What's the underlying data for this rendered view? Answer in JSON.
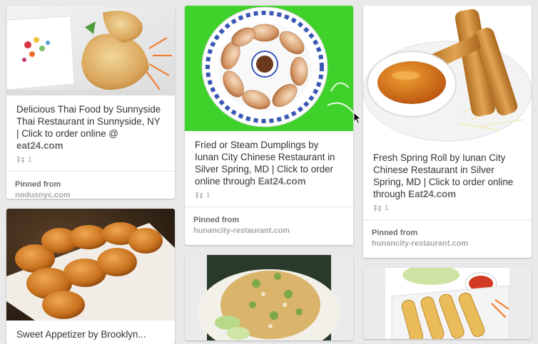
{
  "pins": [
    {
      "id": "p1",
      "description": "Delicious Thai Food by Sunnyside Thai Restaurant in Sunnyside, NY | Click to order online @ ",
      "link_text": "eat24.com",
      "repins": "1",
      "pinned_from_label": "Pinned from",
      "source_domain": "nodusnyc.com"
    },
    {
      "id": "p2",
      "description": "Fried or Steam Dumplings by Iunan City Chinese Restaurant in Silver Spring, MD | Click to order online through ",
      "link_text": "Eat24.com",
      "repins": "1",
      "pinned_from_label": "Pinned from",
      "source_domain": "hunancity-restaurant.com"
    },
    {
      "id": "p3",
      "description": "Fresh Spring Roll by Iunan City Chinese Restaurant in Silver Spring, MD | Click to order online through ",
      "link_text": "Eat24.com",
      "repins": "1",
      "pinned_from_label": "Pinned from",
      "source_domain": "hunancity-restaurant.com"
    },
    {
      "id": "p4",
      "description": "Sweet Appetizer by Brooklyn..."
    }
  ],
  "colors": {
    "background": "#e9e9e9",
    "card": "#ffffff",
    "text": "#333333",
    "muted": "#a7a7a7",
    "dumpling_bg": "#3fd22a"
  },
  "icons": [
    "repin-icon",
    "mouse-pointer-icon"
  ]
}
